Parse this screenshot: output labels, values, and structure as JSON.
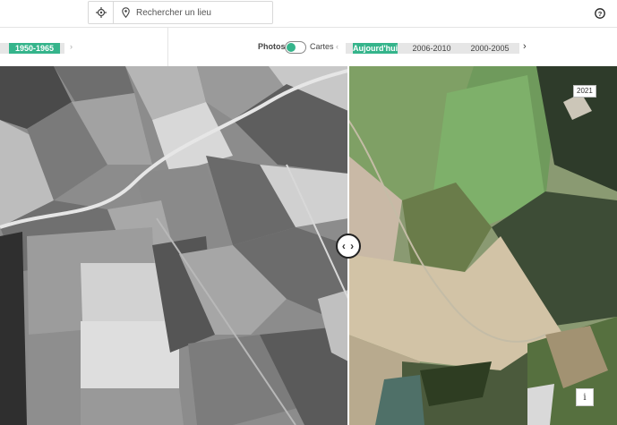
{
  "search": {
    "placeholder": "Rechercher un lieu"
  },
  "left_timeline": {
    "selected_period": "1950-1965"
  },
  "right_timeline": {
    "photos_label": "Photos",
    "cartes_label": "Cartes",
    "periods": [
      "Aujourd'hui",
      "2006-2010",
      "2000-2005"
    ],
    "selected_period": "Aujourd'hui"
  },
  "map": {
    "current_year_badge": "2021",
    "info_label": "i"
  },
  "colors": {
    "accent": "#35b48b"
  },
  "icons": [
    "locate-icon",
    "location-pin-icon",
    "help-icon",
    "chevron-left-icon",
    "chevron-right-icon",
    "swipe-arrows-icon",
    "info-icon"
  ]
}
